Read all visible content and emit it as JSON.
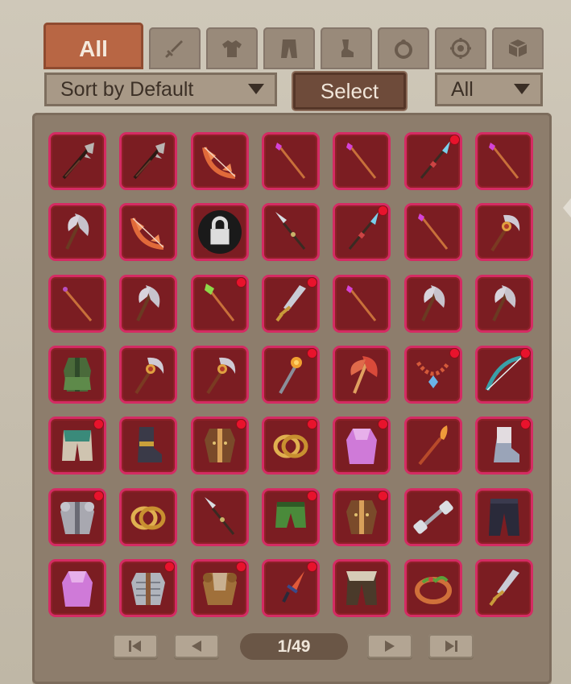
{
  "tabs": [
    {
      "label": "All",
      "icon": "all",
      "active": true
    },
    {
      "label": "",
      "icon": "sword-icon"
    },
    {
      "label": "",
      "icon": "shirt-icon"
    },
    {
      "label": "",
      "icon": "pants-icon"
    },
    {
      "label": "",
      "icon": "boot-icon"
    },
    {
      "label": "",
      "icon": "ring-icon"
    },
    {
      "label": "",
      "icon": "amulet-icon"
    },
    {
      "label": "",
      "icon": "box-icon"
    }
  ],
  "sort": {
    "label": "Sort by Default"
  },
  "select": {
    "label": "Select"
  },
  "filter": {
    "label": "All"
  },
  "inventory": {
    "rows": [
      [
        {
          "item": "halberd-icon"
        },
        {
          "item": "halberd-icon"
        },
        {
          "item": "bow-orange-icon"
        },
        {
          "item": "staff-pink-icon"
        },
        {
          "item": "staff-pink-icon"
        },
        {
          "item": "spear-blue-icon",
          "new": true
        },
        {
          "item": "staff-pink-icon"
        }
      ],
      [
        {
          "item": "axe-icon"
        },
        {
          "item": "bow-orange-icon"
        },
        {
          "item": "shortsword-icon",
          "locked": true
        },
        {
          "item": "spear-silver-icon"
        },
        {
          "item": "spear-blue-icon",
          "new": true
        },
        {
          "item": "staff-pink-icon"
        },
        {
          "item": "crescent-staff-icon"
        }
      ],
      [
        {
          "item": "staff-plain-icon"
        },
        {
          "item": "axe-icon"
        },
        {
          "item": "staff-green-icon",
          "new": true
        },
        {
          "item": "shortsword-icon",
          "new": true
        },
        {
          "item": "staff-pink-icon"
        },
        {
          "item": "axe-icon"
        },
        {
          "item": "axe-icon"
        }
      ],
      [
        {
          "item": "robe-green-icon"
        },
        {
          "item": "crescent-staff-icon"
        },
        {
          "item": "crescent-staff-icon"
        },
        {
          "item": "scepter-orange-icon",
          "new": true
        },
        {
          "item": "axe-red-icon"
        },
        {
          "item": "necklace-icon",
          "new": true
        },
        {
          "item": "bow-teal-icon",
          "new": true
        }
      ],
      [
        {
          "item": "pants-teal-icon",
          "new": true
        },
        {
          "item": "boots-dark-icon"
        },
        {
          "item": "coat-brown-icon",
          "new": true
        },
        {
          "item": "rings-gold-icon",
          "new": true
        },
        {
          "item": "robe-purple-icon",
          "new": true
        },
        {
          "item": "torch-staff-icon"
        },
        {
          "item": "boots-steel-icon",
          "new": true
        }
      ],
      [
        {
          "item": "plate-armor-icon",
          "new": true
        },
        {
          "item": "rings-gold-icon"
        },
        {
          "item": "spear-silver-icon"
        },
        {
          "item": "pants-green-icon",
          "new": true
        },
        {
          "item": "coat-brown-icon",
          "new": true
        },
        {
          "item": "dumbbell-icon"
        },
        {
          "item": "pants-dark-icon"
        }
      ],
      [
        {
          "item": "robe-purple-icon"
        },
        {
          "item": "chainmail-icon",
          "new": true
        },
        {
          "item": "leather-armor-icon",
          "new": true
        },
        {
          "item": "dagger-red-icon",
          "new": true
        },
        {
          "item": "pants-brown-icon"
        },
        {
          "item": "ring-leaf-icon"
        },
        {
          "item": "shortsword-icon"
        }
      ]
    ]
  },
  "pager": {
    "page": "1/49"
  },
  "colors": {
    "slot_bg": "#7b1d22",
    "slot_border": "#d42b63",
    "tab_active": "#b86644",
    "new_dot": "#e8132c"
  }
}
